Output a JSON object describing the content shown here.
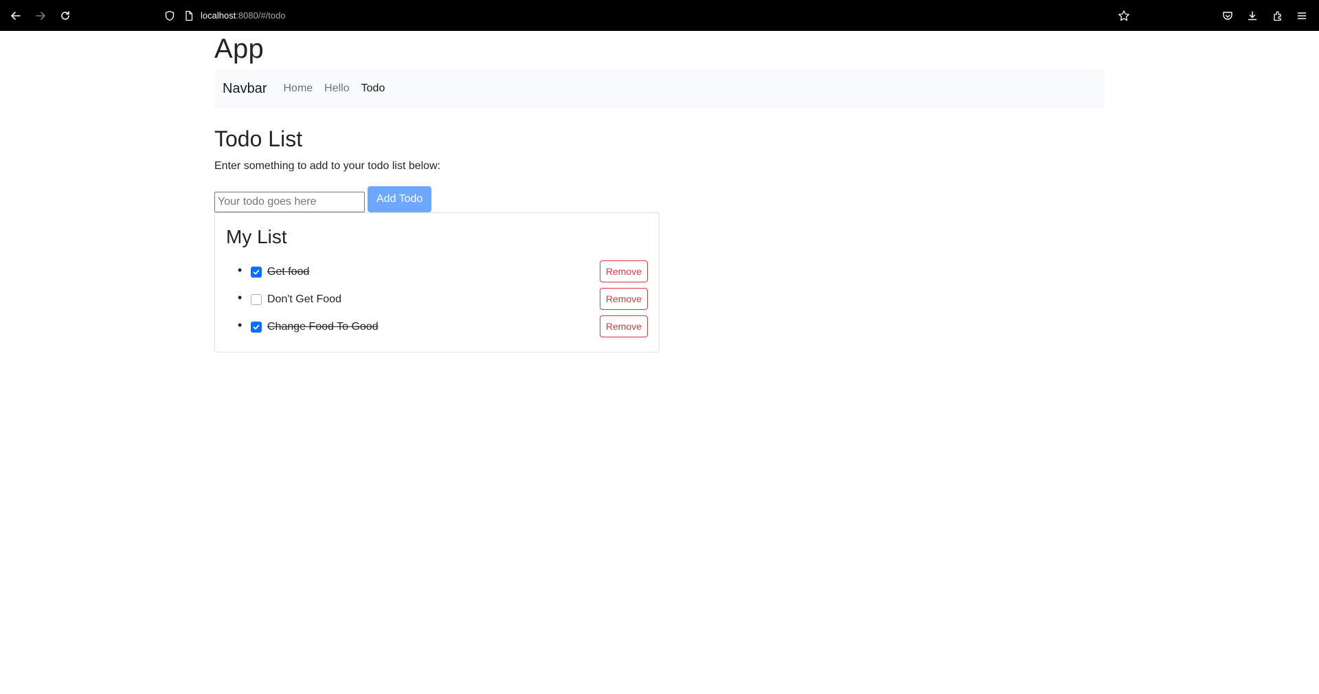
{
  "browser": {
    "url_host": "localhost",
    "url_rest": ":8080/#/todo"
  },
  "app": {
    "title": "App"
  },
  "navbar": {
    "brand": "Navbar",
    "links": [
      {
        "label": "Home",
        "active": false
      },
      {
        "label": "Hello",
        "active": false
      },
      {
        "label": "Todo",
        "active": true
      }
    ]
  },
  "page": {
    "title": "Todo List",
    "intro": "Enter something to add to your todo list below:"
  },
  "form": {
    "input_value": "",
    "input_placeholder": "Your todo goes here",
    "add_label": "Add Todo"
  },
  "list": {
    "title": "My List",
    "remove_label": "Remove",
    "items": [
      {
        "text": "Get food",
        "done": true
      },
      {
        "text": "Don't Get Food",
        "done": false
      },
      {
        "text": "Change Food To Good",
        "done": true
      }
    ]
  },
  "colors": {
    "primary": "#0d6efd",
    "add_button": "#6ea8fe",
    "danger": "#dc3545",
    "navbar_bg": "#f8f9fa"
  }
}
